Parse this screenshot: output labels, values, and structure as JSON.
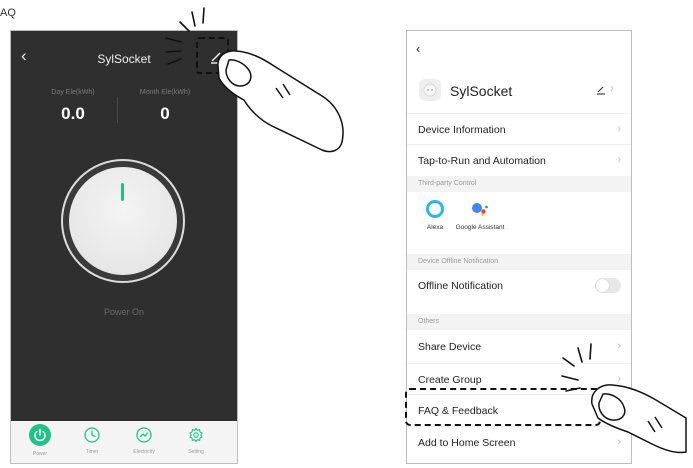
{
  "corner_label": "AQ",
  "left_screen": {
    "title": "SylSocket",
    "back_icon": "chevron-left-icon",
    "edit_icon": "pencil-icon",
    "stats": [
      {
        "label": "Day Ele(kWh)",
        "value": "0.0"
      },
      {
        "label": "Month Ele(kWh)",
        "value": "0"
      }
    ],
    "status": "Power On",
    "tabs": [
      {
        "label": "Power",
        "icon": "power-icon"
      },
      {
        "label": "Timer",
        "icon": "clock-icon"
      },
      {
        "label": "Electricity",
        "icon": "electricity-icon"
      },
      {
        "label": "Setting",
        "icon": "gear-icon"
      }
    ],
    "colors": {
      "background": "#2f2f2f",
      "accent": "#21c28a",
      "tabbar": "#f4f4f4"
    }
  },
  "right_screen": {
    "back_icon": "chevron-left-icon",
    "device_name": "SylSocket",
    "rows": {
      "device_information": "Device Information",
      "tap_to_run": "Tap-to-Run and Automation",
      "offline_notification": "Offline Notification",
      "share_device": "Share Device",
      "create_group": "Create Group",
      "faq_feedback": "FAQ & Feedback",
      "add_home_screen": "Add to Home Screen"
    },
    "sections": {
      "third_party": "Third-party Control",
      "offline": "Device Offline Notification",
      "others": "Others"
    },
    "third_party_services": [
      {
        "label": "Alexa",
        "icon": "alexa-icon"
      },
      {
        "label": "Google Assistant",
        "icon": "google-assistant-icon"
      }
    ],
    "offline_toggle_on": false
  }
}
